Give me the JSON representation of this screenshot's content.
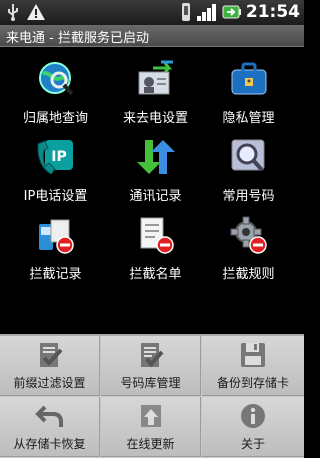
{
  "status_bar": {
    "time": "21:54"
  },
  "title": "来电通 - 拦截服务已启动",
  "grid": [
    {
      "label": "归属地查询",
      "icon": "globe-search-icon"
    },
    {
      "label": "来去电设置",
      "icon": "contact-call-settings-icon"
    },
    {
      "label": "隐私管理",
      "icon": "privacy-briefcase-icon"
    },
    {
      "label": "IP电话设置",
      "icon": "ip-phone-icon"
    },
    {
      "label": "通讯记录",
      "icon": "updown-arrows-icon"
    },
    {
      "label": "常用号码",
      "icon": "magnifier-icon"
    },
    {
      "label": "拦截记录",
      "icon": "blocked-phone-log-icon"
    },
    {
      "label": "拦截名单",
      "icon": "blocked-list-icon"
    },
    {
      "label": "拦截规则",
      "icon": "blocked-rule-gear-icon"
    }
  ],
  "menu": [
    {
      "label": "前缀过滤设置",
      "icon": "clipboard-check-icon"
    },
    {
      "label": "号码库管理",
      "icon": "clipboard-list-check-icon"
    },
    {
      "label": "备份到存储卡",
      "icon": "floppy-save-icon"
    },
    {
      "label": "从存储卡恢复",
      "icon": "undo-arrow-icon"
    },
    {
      "label": "在线更新",
      "icon": "upload-arrow-icon"
    },
    {
      "label": "关于",
      "icon": "info-icon"
    }
  ]
}
